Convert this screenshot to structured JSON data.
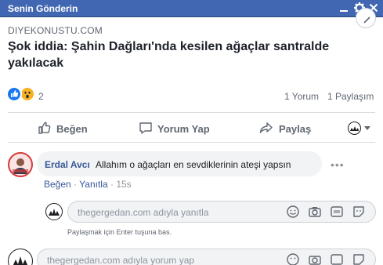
{
  "window": {
    "title": "Senin Gönderin"
  },
  "post": {
    "domain": "DIYEKONUSTU.COM",
    "headline": "Şok iddia: Şahin Dağları'nda kesilen ağaçlar santralde yakılacak",
    "reaction_count": "2",
    "comments_count": "1 Yorum",
    "shares_count": "1 Paylaşım"
  },
  "actions": {
    "like": "Beğen",
    "comment": "Yorum Yap",
    "share": "Paylaş"
  },
  "comment": {
    "author": "Erdal Avcı",
    "text": "Allahım o ağaçları en sevdiklerinin ateşi yapsın",
    "like": "Beğen",
    "reply": "Yanıtla",
    "time": "15s",
    "separator": "·"
  },
  "reply_box": {
    "placeholder": "thegergedan.com adıyla yanıtla",
    "hint": "Paylaşmak için Enter tuşuna bas."
  },
  "comment_box": {
    "placeholder": "thegergedan.com adıyla yorum yap"
  },
  "colors": {
    "header": "#4267b2",
    "link": "#385898",
    "like": "#1877f2",
    "wow": "#f7b125"
  }
}
